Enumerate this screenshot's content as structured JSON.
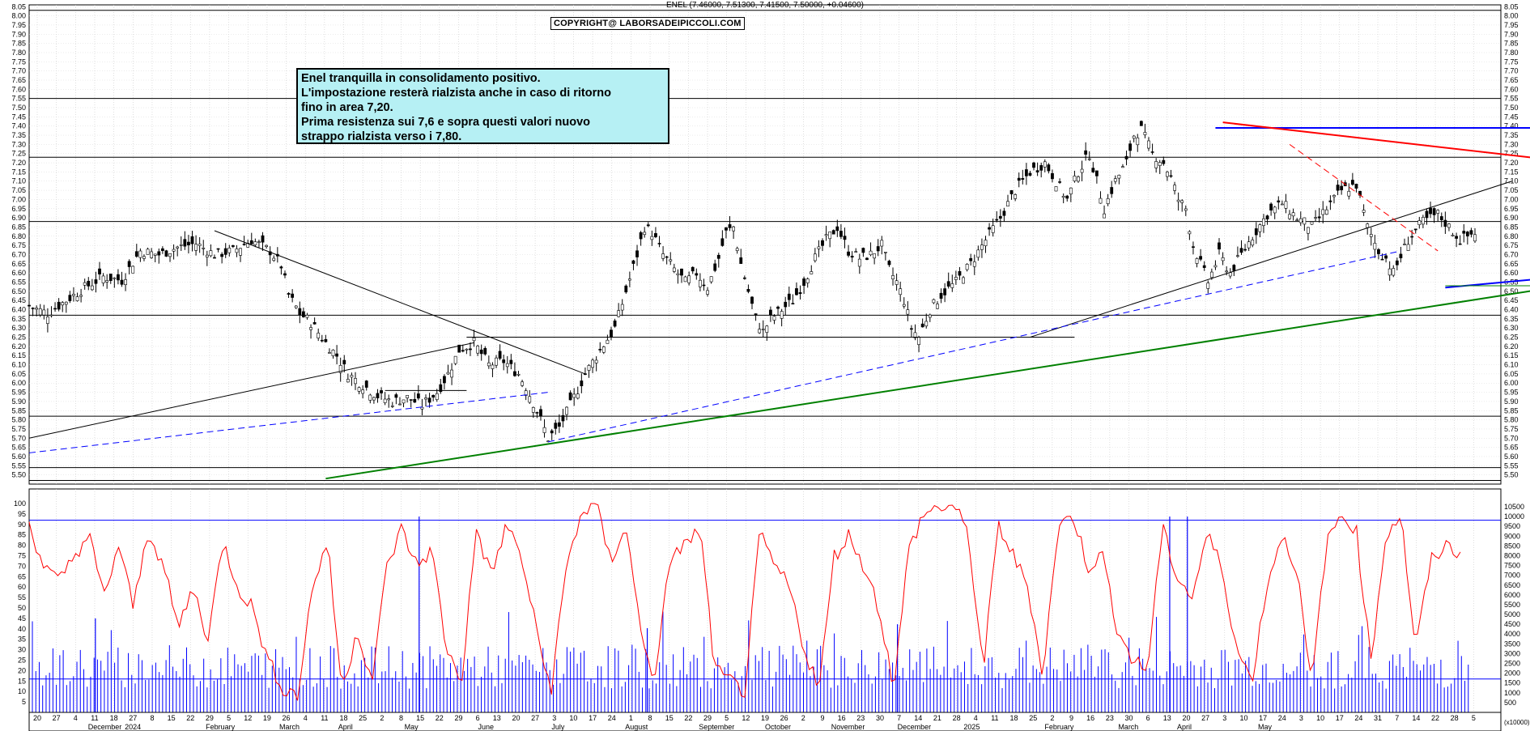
{
  "header": "ENEL (7.46000, 7.51300, 7.41500, 7.50000, +0.04600)",
  "copyright": "COPYRIGHT@ LABORSADEIPICCOLI.COM",
  "note": {
    "lines": [
      "Enel tranquilla in consolidamento positivo.",
      "L'impostazione resterà rialzista anche in caso di  ritorno",
      "fino in area 7,20.",
      "Prima resistenza sui 7,6 e sopra questi valori nuovo",
      "strappo rialzista verso i 7,80."
    ]
  },
  "volume_unit": "(x10000)",
  "chart_data": [
    {
      "type": "candlestick",
      "ticker": "ENEL",
      "ylim": [
        5.45,
        8.06
      ],
      "yticks": [
        "8.05",
        "8.00",
        "7.95",
        "7.90",
        "7.85",
        "7.80",
        "7.75",
        "7.70",
        "7.65",
        "7.60",
        "7.55",
        "7.50",
        "7.45",
        "7.40",
        "7.35",
        "7.30",
        "7.25",
        "7.20",
        "7.15",
        "7.10",
        "7.05",
        "7.00",
        "6.95",
        "6.90",
        "6.85",
        "6.80",
        "6.75",
        "6.70",
        "6.65",
        "6.60",
        "6.55",
        "6.50",
        "6.45",
        "6.40",
        "6.35",
        "6.30",
        "6.25",
        "6.20",
        "6.15",
        "6.10",
        "6.05",
        "6.00",
        "5.95",
        "5.90",
        "5.85",
        "5.80",
        "5.75",
        "5.70",
        "5.65",
        "5.60",
        "5.55",
        "5.50"
      ],
      "x_range": [
        0,
        390
      ],
      "horizontal_levels": [
        8.03,
        7.55,
        7.23,
        6.88,
        6.37,
        5.82,
        5.54,
        5.47
      ],
      "path": [
        [
          0,
          6.42
        ],
        [
          5,
          6.38
        ],
        [
          10,
          6.45
        ],
        [
          15,
          6.52
        ],
        [
          20,
          6.58
        ],
        [
          25,
          6.56
        ],
        [
          30,
          6.72
        ],
        [
          35,
          6.7
        ],
        [
          40,
          6.74
        ],
        [
          45,
          6.76
        ],
        [
          50,
          6.7
        ],
        [
          55,
          6.72
        ],
        [
          60,
          6.78
        ],
        [
          65,
          6.72
        ],
        [
          68,
          6.64
        ],
        [
          70,
          6.48
        ],
        [
          73,
          6.38
        ],
        [
          76,
          6.33
        ],
        [
          80,
          6.22
        ],
        [
          83,
          6.15
        ],
        [
          86,
          6.05
        ],
        [
          90,
          5.99
        ],
        [
          94,
          5.93
        ],
        [
          98,
          5.9
        ],
        [
          102,
          5.92
        ],
        [
          106,
          5.88
        ],
        [
          110,
          5.95
        ],
        [
          113,
          6.05
        ],
        [
          116,
          6.18
        ],
        [
          120,
          6.22
        ],
        [
          124,
          6.1
        ],
        [
          128,
          6.12
        ],
        [
          132,
          6.05
        ],
        [
          134,
          5.98
        ],
        [
          137,
          5.85
        ],
        [
          140,
          5.7
        ],
        [
          143,
          5.76
        ],
        [
          146,
          5.88
        ],
        [
          150,
          6.05
        ],
        [
          154,
          6.18
        ],
        [
          158,
          6.3
        ],
        [
          161,
          6.5
        ],
        [
          164,
          6.7
        ],
        [
          166,
          6.85
        ],
        [
          168,
          6.82
        ],
        [
          171,
          6.7
        ],
        [
          174,
          6.62
        ],
        [
          177,
          6.55
        ],
        [
          180,
          6.6
        ],
        [
          183,
          6.52
        ],
        [
          186,
          6.68
        ],
        [
          188,
          6.82
        ],
        [
          190,
          6.85
        ],
        [
          192,
          6.65
        ],
        [
          194,
          6.5
        ],
        [
          196,
          6.35
        ],
        [
          198,
          6.28
        ],
        [
          200,
          6.35
        ],
        [
          203,
          6.4
        ],
        [
          206,
          6.45
        ],
        [
          209,
          6.55
        ],
        [
          212,
          6.68
        ],
        [
          215,
          6.78
        ],
        [
          218,
          6.85
        ],
        [
          221,
          6.72
        ],
        [
          224,
          6.68
        ],
        [
          227,
          6.7
        ],
        [
          230,
          6.75
        ],
        [
          232,
          6.62
        ],
        [
          234,
          6.55
        ],
        [
          236,
          6.45
        ],
        [
          238,
          6.3
        ],
        [
          240,
          6.25
        ],
        [
          243,
          6.4
        ],
        [
          246,
          6.48
        ],
        [
          250,
          6.55
        ],
        [
          254,
          6.65
        ],
        [
          258,
          6.78
        ],
        [
          262,
          6.9
        ],
        [
          266,
          7.05
        ],
        [
          270,
          7.15
        ],
        [
          274,
          7.2
        ],
        [
          277,
          7.1
        ],
        [
          280,
          7.0
        ],
        [
          283,
          7.15
        ],
        [
          286,
          7.25
        ],
        [
          288,
          7.1
        ],
        [
          290,
          6.95
        ],
        [
          293,
          7.1
        ],
        [
          296,
          7.2
        ],
        [
          298,
          7.35
        ],
        [
          300,
          7.38
        ],
        [
          303,
          7.25
        ],
        [
          306,
          7.2
        ],
        [
          308,
          7.12
        ],
        [
          310,
          7.0
        ],
        [
          312,
          6.95
        ],
        [
          314,
          6.75
        ],
        [
          316,
          6.65
        ],
        [
          318,
          6.55
        ],
        [
          321,
          6.7
        ],
        [
          324,
          6.6
        ],
        [
          327,
          6.7
        ],
        [
          330,
          6.8
        ],
        [
          334,
          6.92
        ],
        [
          338,
          6.98
        ],
        [
          342,
          6.9
        ],
        [
          346,
          6.85
        ],
        [
          350,
          6.95
        ],
        [
          354,
          7.05
        ],
        [
          358,
          7.08
        ],
        [
          361,
          6.85
        ],
        [
          364,
          6.72
        ],
        [
          366,
          6.68
        ],
        [
          368,
          6.6
        ],
        [
          372,
          6.78
        ],
        [
          376,
          6.88
        ],
        [
          380,
          6.92
        ],
        [
          383,
          6.85
        ],
        [
          386,
          6.78
        ],
        [
          390,
          6.82
        ]
      ],
      "lines": [
        {
          "name": "",
          "color": "#000000",
          "points": [
            [
              0,
              5.7
            ],
            [
              120,
              6.22
            ]
          ]
        },
        {
          "name": "",
          "color": "#000000",
          "points": [
            [
              50,
              6.83
            ],
            [
              150,
              6.05
            ]
          ]
        },
        {
          "name": "",
          "color": "#000000",
          "points": [
            [
              96,
              5.96
            ],
            [
              118,
              5.96
            ]
          ]
        },
        {
          "name": "",
          "color": "#000000",
          "points": [
            [
              118,
              6.25
            ],
            [
              282,
              6.25
            ]
          ]
        },
        {
          "name": "",
          "color": "#000000",
          "points": [
            [
              270,
              6.25
            ],
            [
              400,
              7.1
            ]
          ]
        },
        {
          "name": "",
          "color": "#0000ff",
          "dash": true,
          "points": [
            [
              0,
              5.62
            ],
            [
              140,
              5.95
            ]
          ]
        },
        {
          "name": "",
          "color": "#0000ff",
          "dash": true,
          "points": [
            [
              140,
              5.68
            ],
            [
              370,
              6.72
            ]
          ]
        },
        {
          "name": "",
          "color": "#008000",
          "points": [
            [
              80,
              5.48
            ],
            [
              500,
              6.8
            ]
          ]
        },
        {
          "name": "",
          "color": "#0000ff",
          "points": [
            [
              382,
              6.52
            ],
            [
              500,
              6.74
            ]
          ]
        },
        {
          "name": "",
          "color": "#008000",
          "thin": true,
          "points": [
            [
              382,
              6.53
            ],
            [
              500,
              6.53
            ]
          ]
        },
        {
          "name": "",
          "color": "#0000ff",
          "points": [
            [
              320,
              7.39
            ],
            [
              488,
              7.39
            ]
          ]
        },
        {
          "name": "",
          "color": "#ff0000",
          "points": [
            [
              322,
              7.42
            ],
            [
              470,
              7.08
            ]
          ]
        },
        {
          "name": "",
          "color": "#ff0000",
          "dash": true,
          "points": [
            [
              340,
              7.3
            ],
            [
              380,
              6.72
            ]
          ]
        }
      ]
    },
    {
      "type": "bar+line",
      "panel": "volume-oscillator",
      "oscillator_ylim": [
        0,
        100
      ],
      "oscillator_yticks": [
        "100",
        "95",
        "90",
        "85",
        "80",
        "75",
        "70",
        "65",
        "60",
        "55",
        "50",
        "45",
        "40",
        "35",
        "30",
        "25",
        "20",
        "15",
        "10",
        "5"
      ],
      "volume_ylim": [
        0,
        10500
      ],
      "volume_yticks": [
        "10500",
        "10000",
        "9500",
        "9000",
        "8500",
        "8000",
        "7500",
        "7000",
        "6500",
        "6000",
        "5500",
        "5000",
        "4500",
        "4000",
        "3500",
        "3000",
        "2500",
        "2000",
        "1500",
        "1000",
        "500"
      ],
      "levels": [
        92,
        16
      ],
      "oscillator": [
        90,
        70,
        62,
        75,
        85,
        55,
        80,
        50,
        88,
        70,
        40,
        60,
        35,
        82,
        60,
        50,
        25,
        12,
        8,
        60,
        82,
        10,
        40,
        15,
        70,
        88,
        70,
        78,
        30,
        15,
        88,
        65,
        90,
        75,
        40,
        10,
        68,
        95,
        100,
        72,
        90,
        40,
        15,
        75,
        80,
        88,
        20,
        15,
        10,
        85,
        70,
        60,
        30,
        12,
        75,
        85,
        70,
        50,
        12,
        78,
        95,
        98,
        99,
        85,
        20,
        90,
        75,
        60,
        18,
        88,
        95,
        70,
        75,
        40,
        25,
        20,
        88,
        65,
        55,
        85,
        70,
        30,
        15,
        60,
        85,
        70,
        12,
        80,
        95,
        88,
        25,
        85,
        95,
        30,
        72,
        80,
        76
      ],
      "volume_spikes": [
        [
          510,
          10000
        ],
        [
          1045,
          10000
        ],
        [
          120,
          4800
        ],
        [
          770,
          4500
        ],
        [
          260,
          4100
        ]
      ]
    }
  ],
  "x_axis": {
    "day_labels": [
      "20",
      "27",
      "4",
      "11",
      "18",
      "27",
      "8",
      "15",
      "22",
      "29",
      "5",
      "12",
      "19",
      "26",
      "4",
      "11",
      "18",
      "25",
      "2",
      "8",
      "15",
      "22",
      "29",
      "6",
      "13",
      "20",
      "27",
      "3",
      "10",
      "17",
      "24",
      "1",
      "8",
      "15",
      "22",
      "29",
      "5",
      "12",
      "19",
      "26",
      "2",
      "9",
      "16",
      "23",
      "30",
      "7",
      "14",
      "21",
      "28",
      "4",
      "11",
      "18",
      "25",
      "2",
      "9",
      "16",
      "23",
      "30",
      "6",
      "13",
      "20",
      "27",
      "3",
      "10",
      "17",
      "24",
      "3",
      "10",
      "17",
      "24",
      "31",
      "7",
      "14",
      "22",
      "28",
      "5"
    ],
    "month_labels": [
      "December",
      "2024",
      "February",
      "March",
      "April",
      "May",
      "June",
      "July",
      "August",
      "September",
      "October",
      "November",
      "December",
      "2025",
      "February",
      "March",
      "April",
      "May"
    ]
  }
}
